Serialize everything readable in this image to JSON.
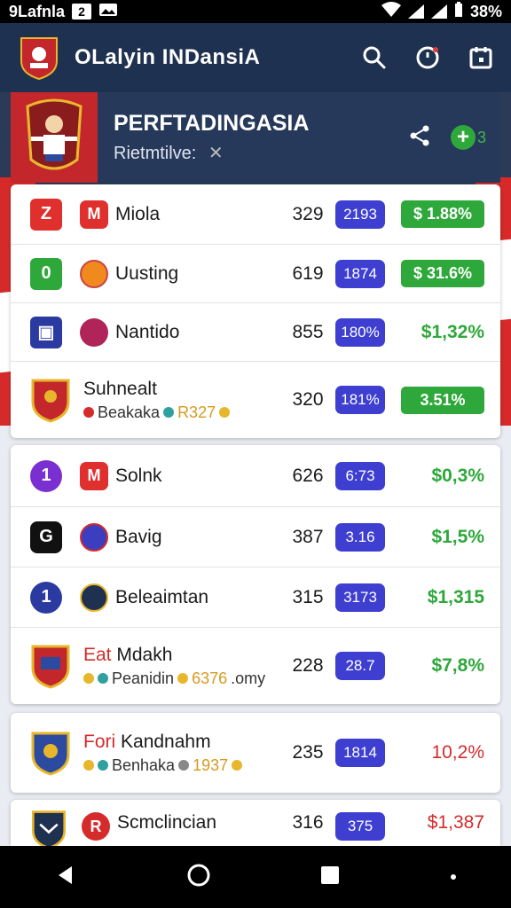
{
  "status_bar": {
    "left_text": "9Lafnla",
    "badge": "2",
    "right_text": "38%"
  },
  "app_bar": {
    "title": "OLalyin INDansiA"
  },
  "banner": {
    "title": "PERFTADINGASIA",
    "subtitle": "Rietmtilve:",
    "plus_suffix": "3"
  },
  "rows_group1": [
    {
      "badge": "Z",
      "team_icon": "M",
      "name": "Miola",
      "num": "329",
      "pill": "2193",
      "change": "$ 1.88%"
    },
    {
      "badge": "0",
      "team_icon": "",
      "name": "Uusting",
      "num": "619",
      "pill": "1874",
      "change": "$ 31.6%"
    },
    {
      "badge": "▣",
      "team_icon": "",
      "name": "Nantido",
      "num": "855",
      "pill": "180%",
      "change": "$1,32%"
    },
    {
      "name": "Suhnealt",
      "sub_label": "Beakaka",
      "sub_value": "R327",
      "num": "320",
      "pill": "181%",
      "change": "3.51%"
    }
  ],
  "rows_group2": [
    {
      "badge": "1",
      "team_icon": "M",
      "name": "Solnk",
      "num": "626",
      "pill": "6:73",
      "change": "$0,3%"
    },
    {
      "badge": "G",
      "team_icon": "",
      "name": "Bavig",
      "num": "387",
      "pill": "3.16",
      "change": "$1,5%"
    },
    {
      "badge": "1",
      "team_icon": "",
      "name": "Beleaimtan",
      "num": "315",
      "pill": "3173",
      "change": "$1,315"
    },
    {
      "name_prefix": "Eat",
      "name": "Mdakh",
      "sub_label": "Peanidin",
      "sub_value": "6376",
      "sub_suffix": ".omy",
      "num": "228",
      "pill": "28.7",
      "change": "$7,8%"
    }
  ],
  "rows_group3": [
    {
      "name_prefix": "Fori",
      "name": "Kandnahm",
      "sub_label": "Benhaka",
      "sub_value": "1937",
      "num": "235",
      "pill": "1814",
      "change": "10,2%"
    }
  ],
  "rows_group4": [
    {
      "team_icon": "R",
      "name": "Scmclincian",
      "num": "316",
      "pill": "375",
      "change": "$1,387"
    }
  ],
  "colors": {
    "primary": "#1f3150",
    "accent_blue": "#3e3fd0",
    "green": "#2ea83a",
    "red": "#d52b2b"
  }
}
